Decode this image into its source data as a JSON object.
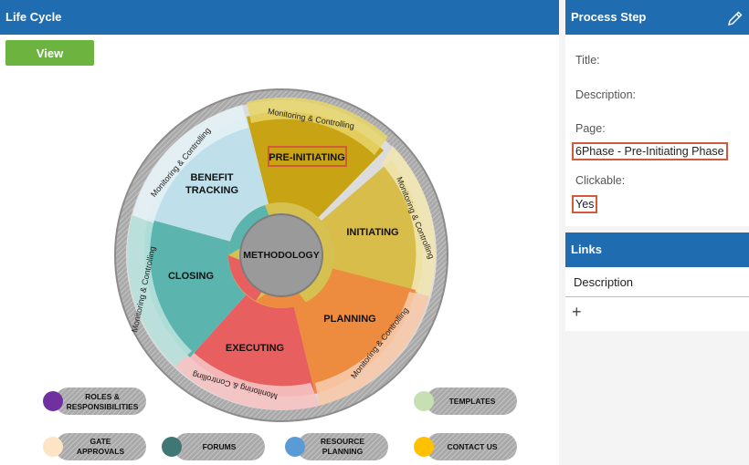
{
  "lifecycle": {
    "title": "Life Cycle",
    "view_label": "View",
    "center_label": "METHODOLOGY",
    "phases": [
      {
        "label_line1": "PRE-INITIATING",
        "label_line2": ""
      },
      {
        "label_line1": "INITIATING",
        "label_line2": ""
      },
      {
        "label_line1": "PLANNING",
        "label_line2": ""
      },
      {
        "label_line1": "EXECUTING",
        "label_line2": ""
      },
      {
        "label_line1": "CLOSING",
        "label_line2": ""
      },
      {
        "label_line1": "BENEFIT",
        "label_line2": "TRACKING"
      }
    ],
    "ring_label": "Monitoring & Controlling",
    "legend": [
      {
        "line1": "ROLES &",
        "line2": "RESPONSIBILITIES",
        "color": "#7030a0"
      },
      {
        "line1": "TEMPLATES",
        "line2": "",
        "color": "#c6e0b4"
      },
      {
        "line1": "GATE",
        "line2": "APPROVALS",
        "color": "#fce4c4"
      },
      {
        "line1": "FORUMS",
        "line2": "",
        "color": "#3f7775"
      },
      {
        "line1": "RESOURCE",
        "line2": "PLANNING",
        "color": "#5b9bd5"
      },
      {
        "line1": "CONTACT US",
        "line2": "",
        "color": "#ffc000"
      }
    ]
  },
  "process_step": {
    "title": "Process Step",
    "title_label": "Title:",
    "description_label": "Description:",
    "page_label": "Page:",
    "page_value": "6Phase - Pre-Initiating Phase",
    "clickable_label": "Clickable:",
    "clickable_value": "Yes"
  },
  "links": {
    "title": "Links",
    "description_header": "Description",
    "add_label": "+"
  },
  "colors": {
    "header_blue": "#1f6cb0",
    "view_green": "#6db33f",
    "highlight_border": "#d05a3a"
  }
}
